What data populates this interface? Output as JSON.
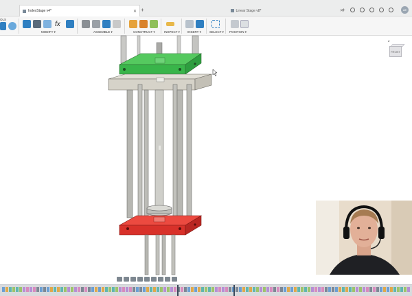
{
  "tabs": {
    "active": {
      "label": "IndexStage v4*"
    },
    "inactive": {
      "label": "Linear Stage v8*"
    }
  },
  "user": {
    "initials": "AE"
  },
  "ribbon": {
    "cut_label": "OLS",
    "groups": [
      {
        "key": "modify",
        "label": "MODIFY ▾"
      },
      {
        "key": "assemble",
        "label": "ASSEMBLE ▾"
      },
      {
        "key": "construct",
        "label": "CONSTRUCT ▾"
      },
      {
        "key": "inspect",
        "label": "INSPECT ▾"
      },
      {
        "key": "insert",
        "label": "INSERT ▾"
      },
      {
        "key": "select",
        "label": "SELECT ▾"
      },
      {
        "key": "position",
        "label": "POSITION ▾"
      }
    ]
  },
  "viewcube": {
    "face": "FRONT",
    "axis_z": "Z"
  },
  "colors": {
    "ribbon_blue": "#2f7fc1",
    "top_plate": "#39b54a",
    "bottom_plate": "#e0312b",
    "rods": "#b7b7b2",
    "slab": "#d6d3c9",
    "timeline": "#d8dadd"
  },
  "icons": [
    "plus-icon",
    "toolbar-icons",
    "avatar",
    "viewcube",
    "model"
  ]
}
